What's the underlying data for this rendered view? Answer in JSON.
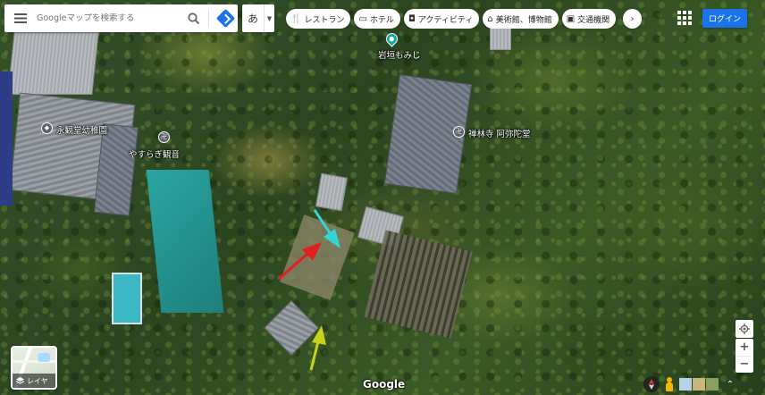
{
  "search": {
    "placeholder": "Googleマップを検索する"
  },
  "ime": {
    "current_char": "あ"
  },
  "chips": [
    {
      "label": "レストラン",
      "icon": "fork-knife-icon"
    },
    {
      "label": "ホテル",
      "icon": "bed-icon"
    },
    {
      "label": "アクティビティ",
      "icon": "camera-icon"
    },
    {
      "label": "美術館、博物館",
      "icon": "museum-icon"
    },
    {
      "label": "交通機関",
      "icon": "train-icon"
    }
  ],
  "header": {
    "login_label": "ログイン"
  },
  "map": {
    "places": [
      {
        "label": "岩垣もみじ",
        "icon": "teal-pin-icon"
      },
      {
        "label": "永観堂幼稚園",
        "icon": "school-pin-icon"
      },
      {
        "label": "やすらぎ観音",
        "icon": "temple-pin-icon"
      },
      {
        "label": "禅林寺 阿弥陀堂",
        "icon": "temple-pin-icon"
      }
    ],
    "annotations": [
      {
        "name": "cyan-arrow",
        "color": "#33d6d6"
      },
      {
        "name": "red-arrow",
        "color": "#e21f1f"
      },
      {
        "name": "yellow-arrow",
        "color": "#c9d21a"
      }
    ]
  },
  "layers": {
    "label": "レイヤ"
  },
  "footer": {
    "logo_text": "Google"
  },
  "colors": {
    "accent": "#1a73e8",
    "teal_pin": "#11a9a0"
  }
}
